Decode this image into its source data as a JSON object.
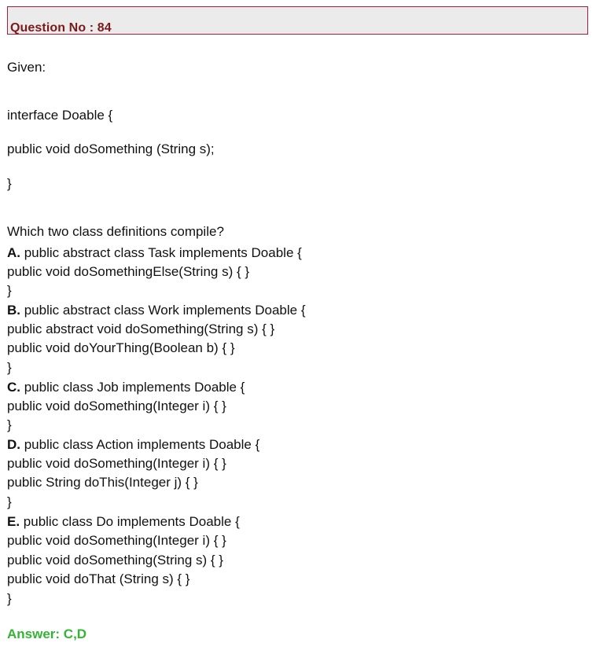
{
  "question": {
    "title": "Question No : 84",
    "given": "Given:",
    "code": [
      "interface Doable {",
      "public void doSomething (String s);",
      "}"
    ],
    "prompt": "Which two class definitions compile?"
  },
  "options": [
    {
      "letter": "A.",
      "header": " public abstract class Task implements Doable {",
      "lines": [
        "public void doSomethingElse(String s) { }",
        "}"
      ]
    },
    {
      "letter": "B.",
      "header": " public abstract class Work implements Doable {",
      "lines": [
        "public abstract void doSomething(String s) { }",
        "public void doYourThing(Boolean b) { }",
        "}"
      ]
    },
    {
      "letter": "C.",
      "header": " public class Job implements Doable {",
      "lines": [
        "public void doSomething(Integer i) { }",
        "}"
      ]
    },
    {
      "letter": "D.",
      "header": " public class Action implements Doable {",
      "lines": [
        "public void doSomething(Integer i) { }",
        "public String doThis(Integer j) { }",
        "}"
      ]
    },
    {
      "letter": "E.",
      "header": " public class Do implements Doable {",
      "lines": [
        "public void doSomething(Integer i) { }",
        "public void doSomething(String s) { }",
        "public void doThat (String s) { }",
        "}"
      ]
    }
  ],
  "answer": "Answer: C,D"
}
